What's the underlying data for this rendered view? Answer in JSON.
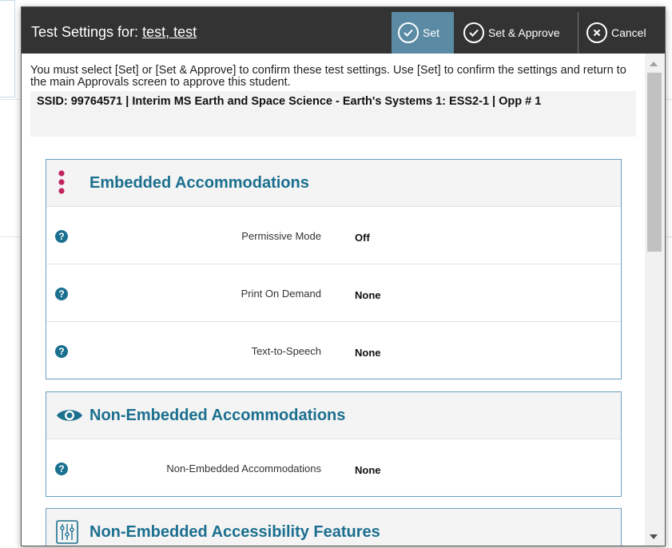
{
  "header": {
    "title_prefix": "Test Settings for: ",
    "student_name": "test, test",
    "set_label": "Set",
    "set_approve_label": "Set & Approve",
    "cancel_label": "Cancel"
  },
  "intro_text": "You must select [Set] or [Set & Approve] to confirm these test settings. Use [Set] to confirm the settings and return to the main Approvals screen to approve this student.",
  "ssid_text": "SSID: 99764571 | Interim MS Earth and Space Science - Earth's Systems 1: ESS2-1 | Opp # 1",
  "sections": [
    {
      "title": "Embedded Accommodations",
      "icon": "vertical-dots-icon",
      "rows": [
        {
          "label": "Permissive Mode",
          "value": "Off"
        },
        {
          "label": "Print On Demand",
          "value": "None"
        },
        {
          "label": "Text-to-Speech",
          "value": "None"
        }
      ]
    },
    {
      "title": "Non-Embedded Accommodations",
      "icon": "eye-icon",
      "rows": [
        {
          "label": "Non-Embedded Accommodations",
          "value": "None"
        }
      ]
    },
    {
      "title": "Non-Embedded Accessibility Features",
      "icon": "sliders-icon",
      "rows": []
    }
  ],
  "help_glyph": "?",
  "colors": {
    "header_bg": "#333333",
    "set_button_bg": "#5b8ba4",
    "section_title": "#1b6f8f",
    "panel_border": "#6a9fc0",
    "dots_accent": "#c0245e"
  }
}
